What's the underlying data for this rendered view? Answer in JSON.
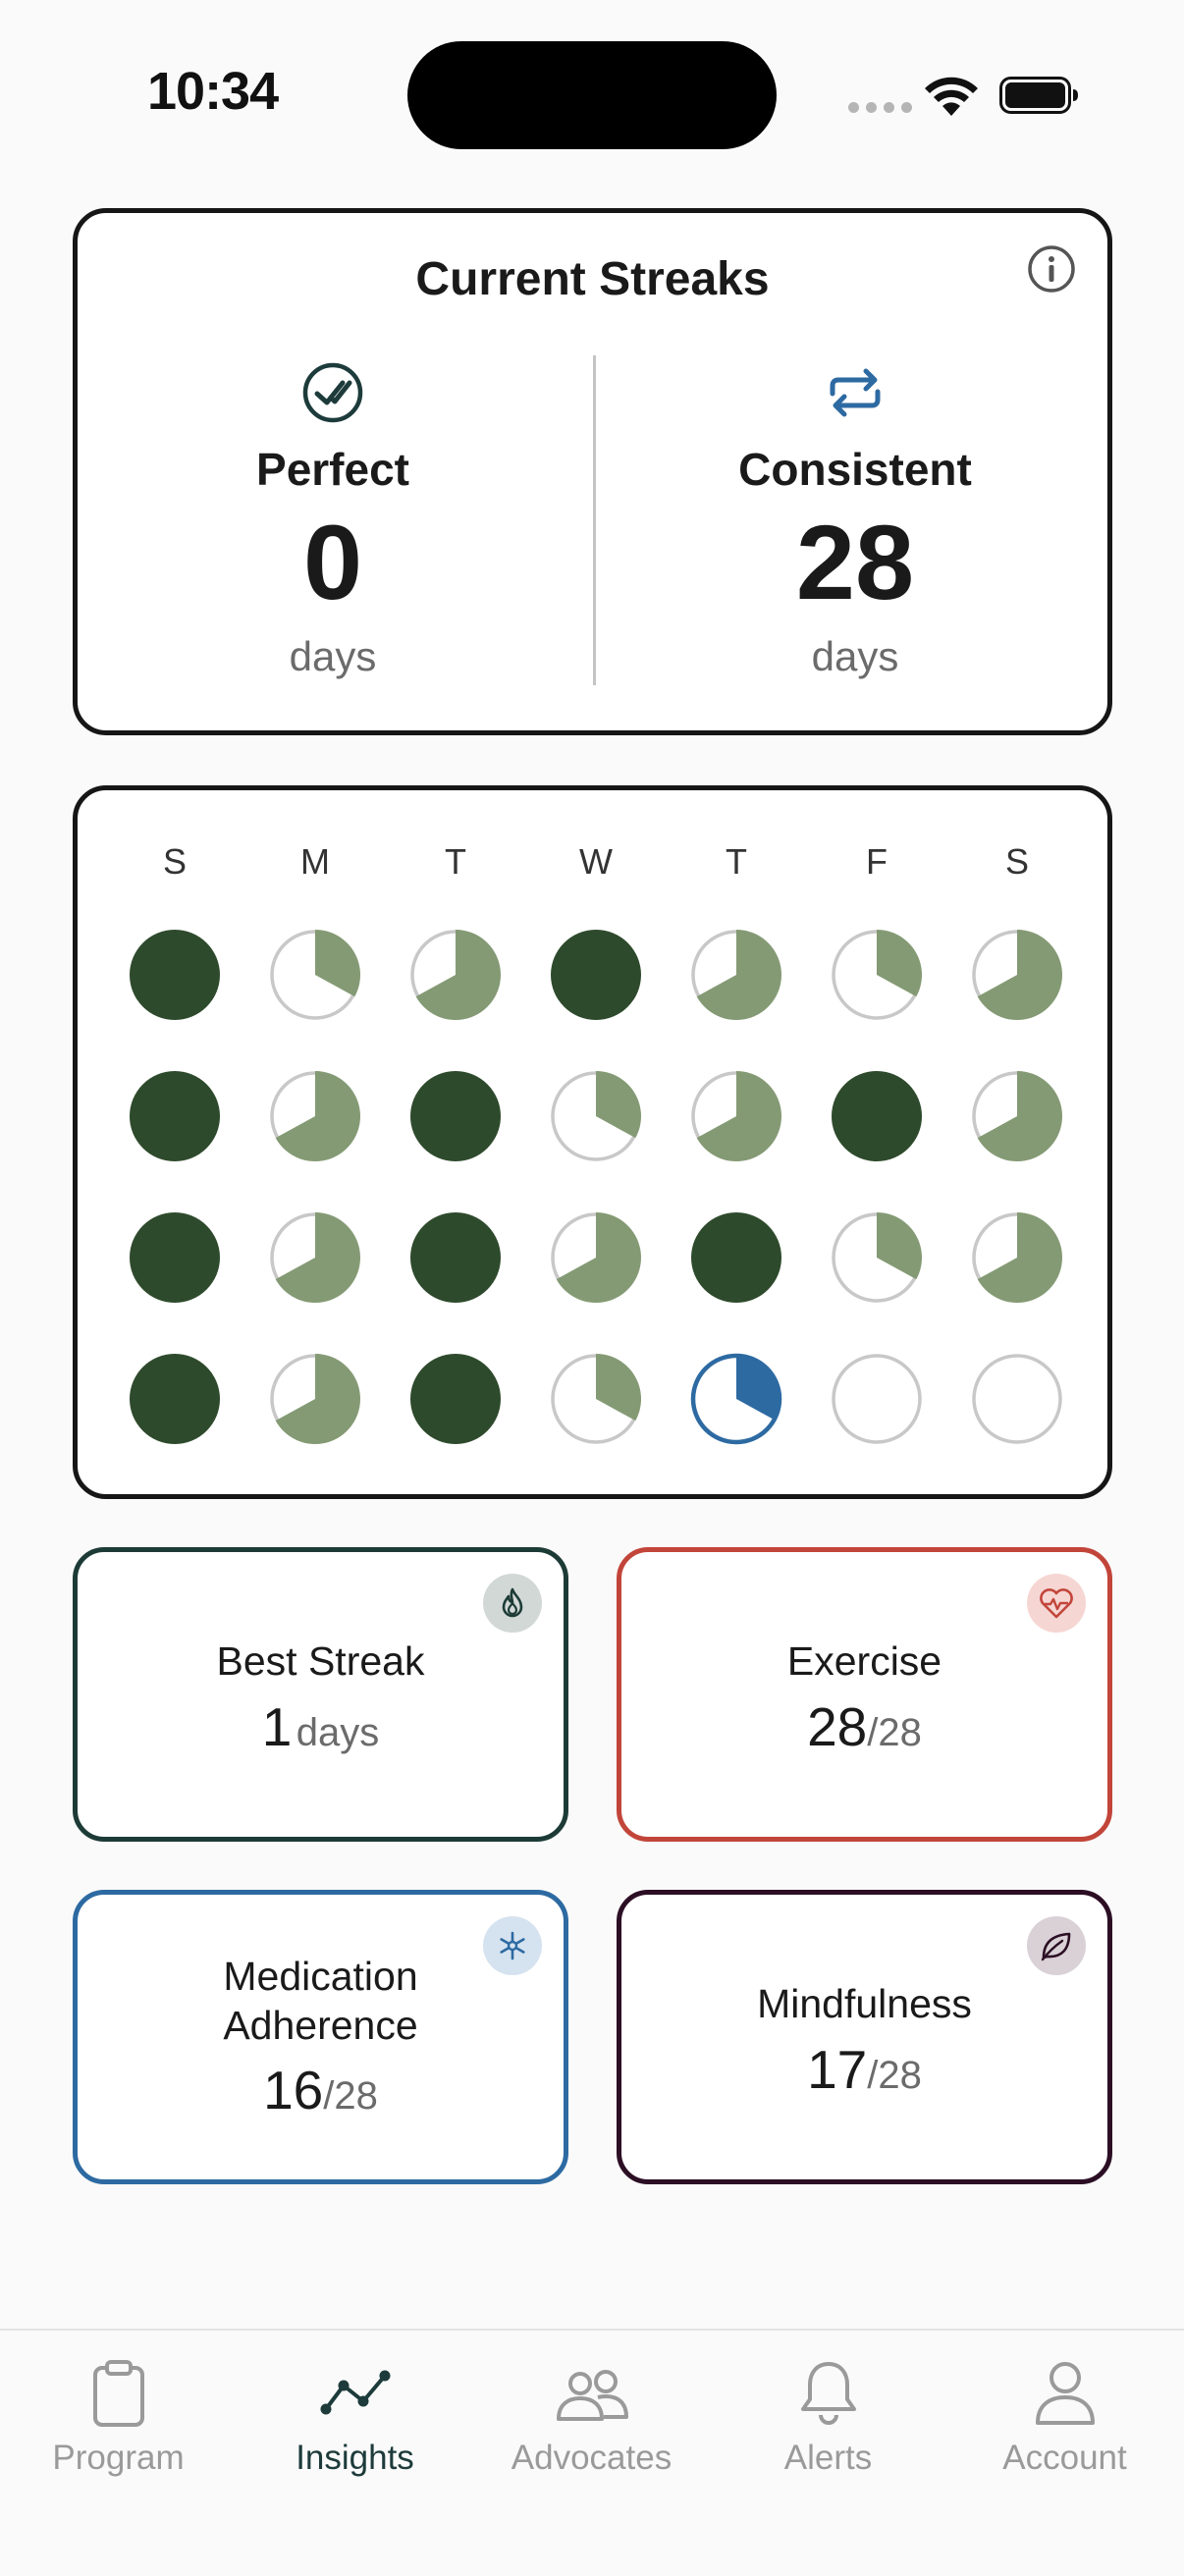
{
  "status_bar": {
    "time": "10:34"
  },
  "streaks": {
    "title": "Current Streaks",
    "perfect": {
      "label": "Perfect",
      "value": "0",
      "unit": "days"
    },
    "consistent": {
      "label": "Consistent",
      "value": "28",
      "unit": "days"
    }
  },
  "calendar": {
    "weekdays": [
      "S",
      "M",
      "T",
      "W",
      "T",
      "F",
      "S"
    ],
    "legend_note": "fill values are fraction of daily goals completed",
    "weeks": [
      [
        1.0,
        0.33,
        0.67,
        1.0,
        0.67,
        0.33,
        0.67
      ],
      [
        1.0,
        0.67,
        1.0,
        0.33,
        0.67,
        1.0,
        0.67
      ],
      [
        1.0,
        0.67,
        1.0,
        0.67,
        1.0,
        0.33,
        0.67
      ],
      [
        1.0,
        0.67,
        1.0,
        0.33,
        0.33,
        0.0,
        0.0
      ]
    ],
    "today": {
      "week": 3,
      "day": 4
    },
    "colors": {
      "complete": "#2e4a2c",
      "partial": "#849a74",
      "empty_ring": "#c8c8c8",
      "today": "#2d6aa2"
    }
  },
  "stats": {
    "best_streak": {
      "label": "Best Streak",
      "value": "1",
      "unit": "days",
      "icon": "flame-icon",
      "color": "#1d3b36"
    },
    "exercise": {
      "label": "Exercise",
      "value": "28",
      "total": "/28",
      "icon": "heart-pulse-icon",
      "color": "#c2453a"
    },
    "medication": {
      "label_line1": "Medication",
      "label_line2": "Adherence",
      "value": "16",
      "total": "/28",
      "icon": "medical-star-icon",
      "color": "#2d6aa2"
    },
    "mindfulness": {
      "label": "Mindfulness",
      "value": "17",
      "total": "/28",
      "icon": "leaf-icon",
      "color": "#2c0f24"
    }
  },
  "tab_bar": {
    "program": "Program",
    "insights": "Insights",
    "advocates": "Advocates",
    "alerts": "Alerts",
    "account": "Account",
    "active": "insights"
  }
}
